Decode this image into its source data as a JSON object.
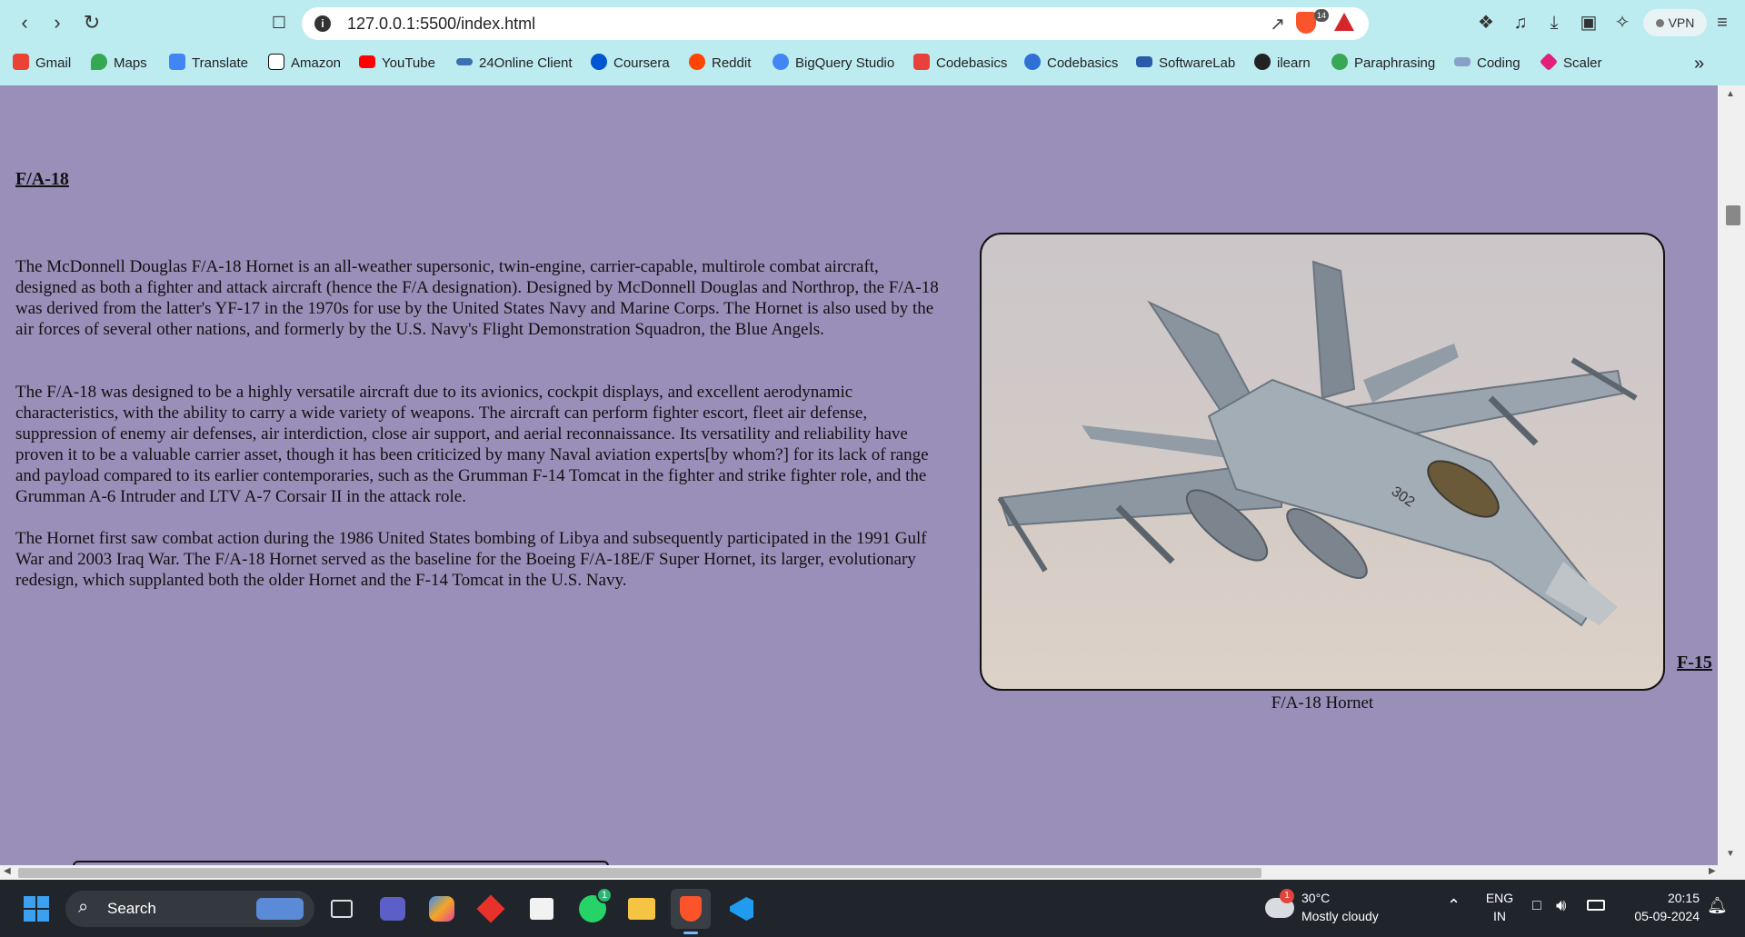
{
  "browser": {
    "url": "127.0.0.1:5500/index.html",
    "brave_badge": "14",
    "vpn_label": "VPN",
    "bookmarks": [
      {
        "label": "Gmail",
        "color": "#ea4335"
      },
      {
        "label": "Maps",
        "color": "#34a853"
      },
      {
        "label": "Translate",
        "color": "#4285f4"
      },
      {
        "label": "Amazon",
        "color": "#111111"
      },
      {
        "label": "YouTube",
        "color": "#ff0000"
      },
      {
        "label": "24Online Client",
        "color": "#3a6fb0"
      },
      {
        "label": "Coursera",
        "color": "#0056d2"
      },
      {
        "label": "Reddit",
        "color": "#ff4500"
      },
      {
        "label": "BigQuery Studio",
        "color": "#4285f4"
      },
      {
        "label": "Codebasics",
        "color": "#e8413c"
      },
      {
        "label": "Codebasics",
        "color": "#2f6fd6"
      },
      {
        "label": "SoftwareLab",
        "color": "#2b5aa8"
      },
      {
        "label": "ilearn",
        "color": "#222222"
      },
      {
        "label": "Paraphrasing",
        "color": "#3aa757"
      },
      {
        "label": "Coding",
        "color": "#8aa0c8"
      },
      {
        "label": "Scaler",
        "color": "#e0207a"
      }
    ],
    "more_label": "»"
  },
  "page": {
    "heading1": "F/A-18",
    "paragraphs": [
      "The McDonnell Douglas F/A-18 Hornet is an all-weather supersonic, twin-engine, carrier-capable, multirole combat aircraft, designed as both a fighter and attack aircraft (hence the F/A designation). Designed by McDonnell Douglas and Northrop, the F/A-18 was derived from the latter's YF-17 in the 1970s for use by the United States Navy and Marine Corps. The Hornet is also used by the air forces of several other nations, and formerly by the U.S. Navy's Flight Demonstration Squadron, the Blue Angels.",
      "The F/A-18 was designed to be a highly versatile aircraft due to its avionics, cockpit displays, and excellent aerodynamic characteristics, with the ability to carry a wide variety of weapons. The aircraft can perform fighter escort, fleet air defense, suppression of enemy air defenses, air interdiction, close air support, and aerial reconnaissance. Its versatility and reliability have proven it to be a valuable carrier asset, though it has been criticized by many Naval aviation experts[by whom?] for its lack of range and payload compared to its earlier contemporaries, such as the Grumman F-14 Tomcat in the fighter and strike fighter role, and the Grumman A-6 Intruder and LTV A-7 Corsair II in the attack role.",
      "The Hornet first saw combat action during the 1986 United States bombing of Libya and subsequently participated in the 1991 Gulf War and 2003 Iraq War. The F/A-18 Hornet served as the baseline for the Boeing F/A-18E/F Super Hornet, its larger, evolutionary redesign, which supplanted both the older Hornet and the F-14 Tomcat in the U.S. Navy."
    ],
    "image_caption": "F/A-18 Hornet",
    "aircraft_number": "302",
    "heading2": "F-15",
    "background_color": "#9a8fb9"
  },
  "taskbar": {
    "search_label": "Search",
    "whatsapp_badge": "1",
    "weather_badge": "1",
    "weather_temp": "30°C",
    "weather_desc": "Mostly cloudy",
    "lang_line1": "ENG",
    "lang_line2": "IN",
    "time": "20:15",
    "date": "05-09-2024"
  }
}
